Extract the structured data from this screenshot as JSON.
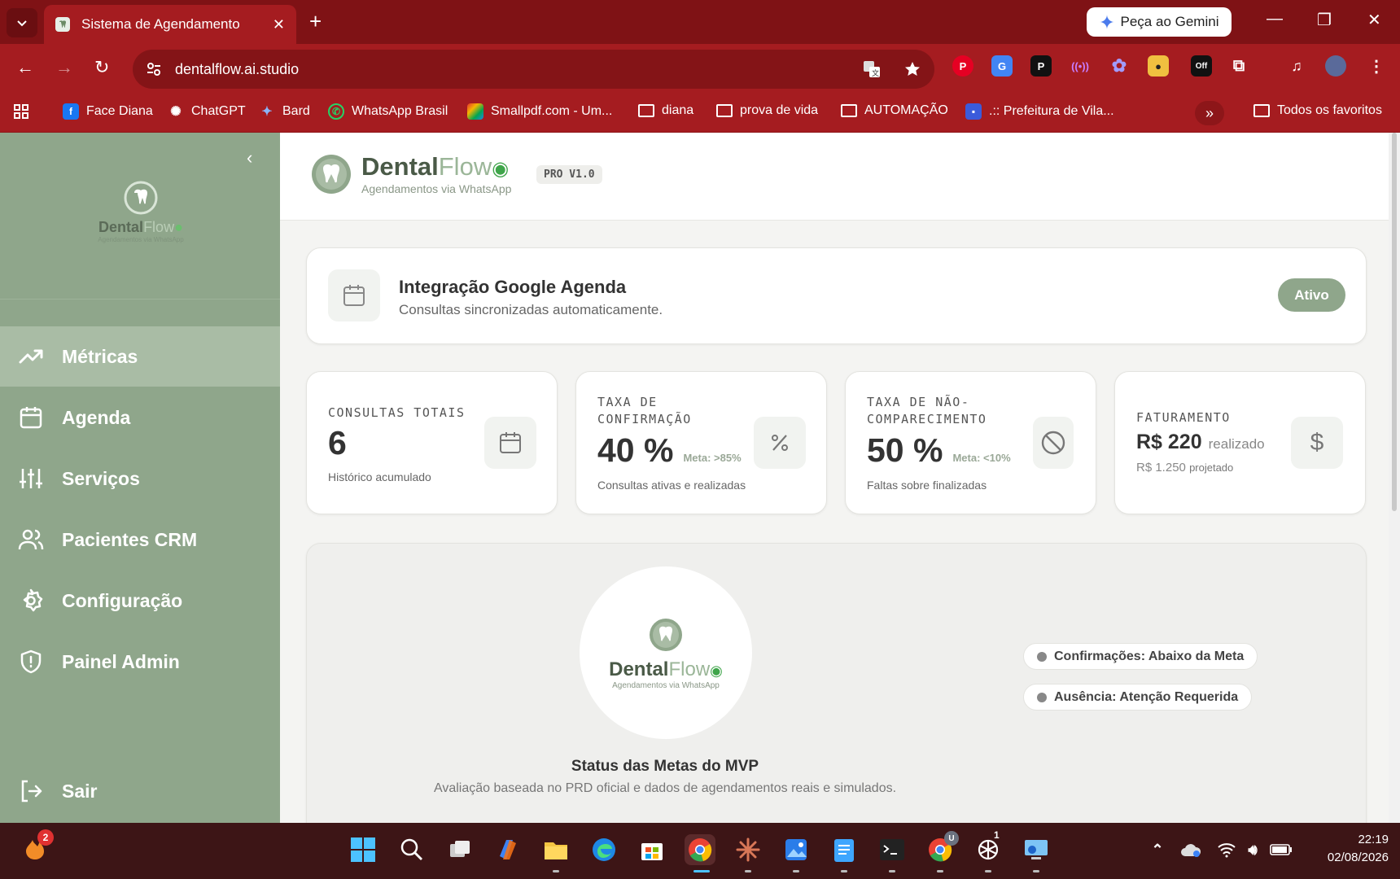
{
  "browser": {
    "tab_title": "Sistema de Agendamento",
    "url": "dentalflow.ai.studio",
    "gemini_label": "Peça ao Gemini",
    "ext_badge": "Off",
    "bookmarks": [
      {
        "label": "Face Diana",
        "icon": "facebook-icon",
        "color": "#1877f2"
      },
      {
        "label": "ChatGPT",
        "icon": "chatgpt-icon",
        "color": "#ffffff"
      },
      {
        "label": "Bard",
        "icon": "bard-icon",
        "color": "#4285f4"
      },
      {
        "label": "WhatsApp Brasil",
        "icon": "whatsapp-icon",
        "color": "#25d366"
      },
      {
        "label": "Smallpdf.com - Um...",
        "icon": "smallpdf-icon",
        "color": "#e5322d"
      },
      {
        "label": "diana",
        "icon": "folder-icon"
      },
      {
        "label": "prova de vida",
        "icon": "folder-icon"
      },
      {
        "label": "AUTOMAÇÃO",
        "icon": "folder-icon"
      },
      {
        "label": ".:: Prefeitura de Vila...",
        "icon": "prefeitura-icon",
        "color": "#3b5bdb"
      }
    ],
    "all_bookmarks_label": "Todos os favoritos"
  },
  "sidebar": {
    "brand_word": "Dental",
    "brand_word_light": "Flow",
    "brand_tag": "Agendamentos via WhatsApp",
    "items": [
      {
        "label": "Métricas",
        "icon": "trending-up-icon",
        "active": true
      },
      {
        "label": "Agenda",
        "icon": "calendar-icon",
        "active": false
      },
      {
        "label": "Serviços",
        "icon": "sliders-icon",
        "active": false
      },
      {
        "label": "Pacientes CRM",
        "icon": "users-icon",
        "active": false
      },
      {
        "label": "Configuração",
        "icon": "gear-icon",
        "active": false
      },
      {
        "label": "Painel Admin",
        "icon": "shield-icon",
        "active": false
      }
    ],
    "logout_label": "Sair"
  },
  "header": {
    "brand_word": "Dental",
    "brand_word_light": "Flow",
    "brand_tag": "Agendamentos via WhatsApp",
    "version_badge": "PRO V1.0"
  },
  "integration": {
    "title": "Integração Google Agenda",
    "subtitle": "Consultas sincronizadas automaticamente.",
    "status": "Ativo"
  },
  "metrics": [
    {
      "label": "CONSULTAS TOTAIS",
      "value": "6",
      "meta": "",
      "sub": "Histórico acumulado",
      "icon": "calendar-icon"
    },
    {
      "label": "TAXA DE CONFIRMAÇÃO",
      "value": "40 %",
      "meta": "Meta: >85%",
      "sub": "Consultas ativas e realizadas",
      "icon": "percent-icon"
    },
    {
      "label": "TAXA DE NÃO-COMPARECIMENTO",
      "value": "50 %",
      "meta": "Meta: <10%",
      "sub": "Faltas sobre finalizadas",
      "icon": "ban-icon"
    },
    {
      "label": "FATURAMENTO",
      "value": "R$ 220",
      "meta": "realizado",
      "sub": "R$ 1.250",
      "sub_suffix": "projetado",
      "icon": "dollar-icon"
    }
  ],
  "status": {
    "title": "Status das Metas do MVP",
    "subtitle": "Avaliação baseada no PRD oficial e dados de agendamentos reais e simulados.",
    "flags": [
      {
        "label": "Confirmações: Abaixo da Meta"
      },
      {
        "label": "Ausência: Atenção Requerida"
      }
    ]
  },
  "taskbar": {
    "notification_count": "2",
    "chrome_profile_badge": "U",
    "chatgpt_badge": "1",
    "time": "22:19",
    "date": "02/08/2026"
  },
  "colors": {
    "sidebar_bg": "#8fa68b",
    "sidebar_active": "#a9bca5",
    "chrome_bar": "#a51c20",
    "accent_green": "#8fa68b"
  }
}
